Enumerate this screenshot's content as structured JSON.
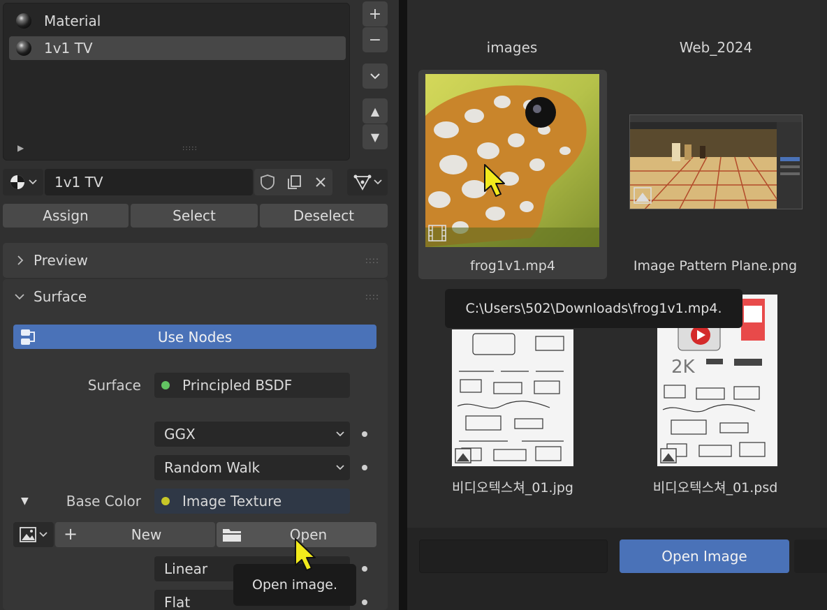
{
  "material_slots": {
    "items": [
      {
        "label": "Material",
        "selected": false
      },
      {
        "label": "1v1 TV",
        "selected": true
      }
    ]
  },
  "side_buttons": {
    "add": "+",
    "remove": "−",
    "menu": "⌄",
    "up": "▲",
    "down": "▼"
  },
  "material_selector": {
    "name": "1v1 TV"
  },
  "assign_row": {
    "assign": "Assign",
    "select": "Select",
    "deselect": "Deselect"
  },
  "panels": {
    "preview": "Preview",
    "surface": "Surface"
  },
  "use_nodes_label": "Use Nodes",
  "surface": {
    "label": "Surface",
    "value": "Principled BSDF",
    "distribution": "GGX",
    "subsurface": "Random Walk",
    "base_color_label": "Base Color",
    "base_color_value": "Image Texture"
  },
  "image_row": {
    "new": "New",
    "open": "Open"
  },
  "interpolation": "Linear",
  "projection": "Flat",
  "tooltip_open": "Open image.",
  "file_browser": {
    "folders": [
      "images",
      "Web_2024"
    ],
    "files": [
      {
        "name": "frog1v1.mp4"
      },
      {
        "name": "Image Pattern Plane.png"
      },
      {
        "name": "비디오텍스쳐_01.jpg"
      },
      {
        "name": "비디오텍스쳐_01.psd"
      }
    ],
    "path_tooltip": "C:\\Users\\502\\Downloads\\frog1v1.mp4.",
    "open_button": "Open Image"
  },
  "colors": {
    "accent": "#4a72b8",
    "panel": "#303030",
    "browser_bg": "#2b2b2b"
  }
}
